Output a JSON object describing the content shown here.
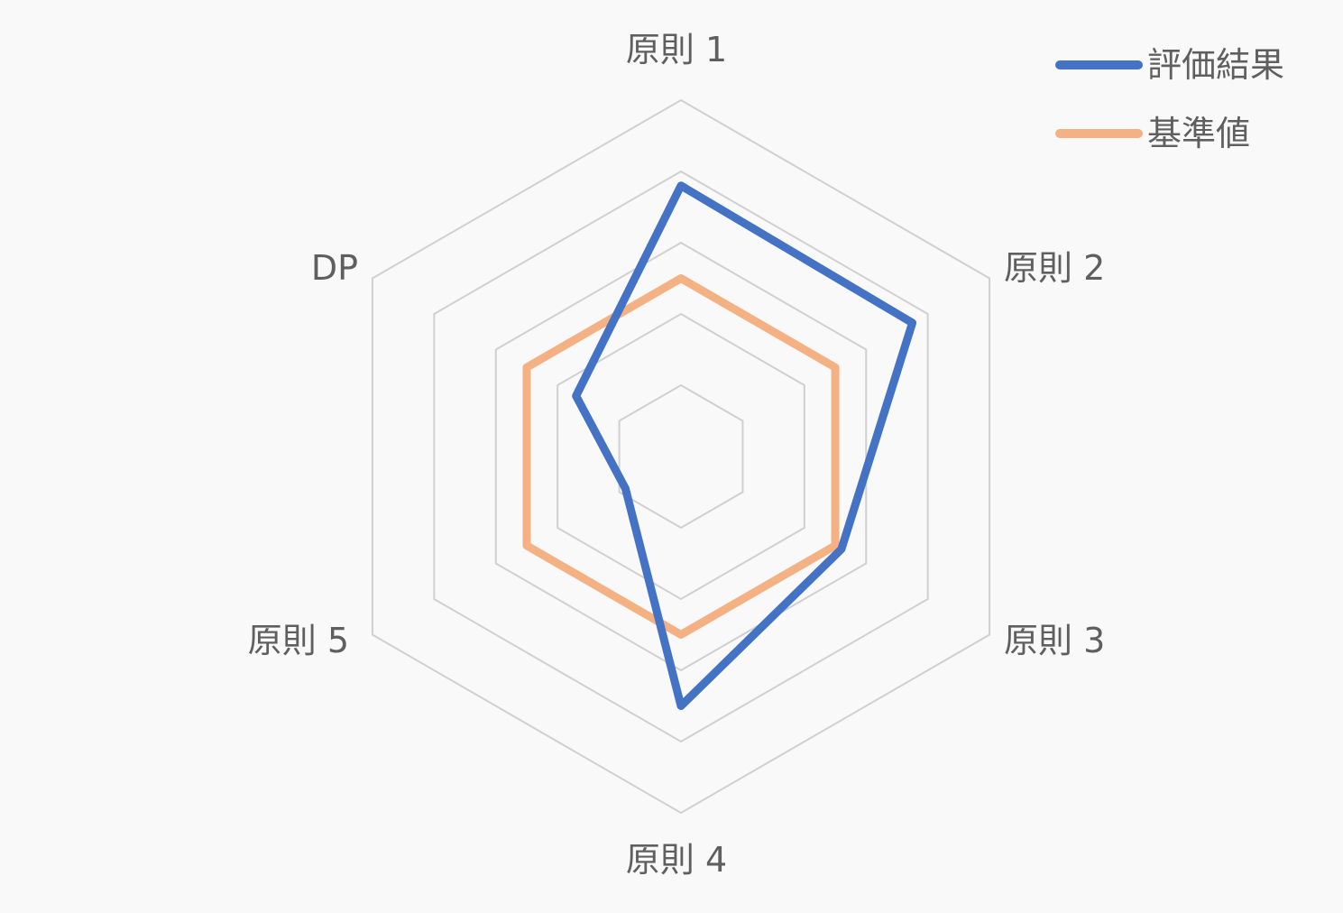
{
  "chart_data": {
    "type": "radar",
    "categories": [
      "原則 1",
      "原則 2",
      "原則 3",
      "原則 4",
      "原則 5",
      "DP"
    ],
    "series": [
      {
        "name": "評価結果",
        "values": [
          3.8,
          3.75,
          2.6,
          3.5,
          0.9,
          1.7
        ],
        "color": "#4472c4"
      },
      {
        "name": "基準値",
        "values": [
          2.5,
          2.5,
          2.5,
          2.5,
          2.5,
          2.5
        ],
        "color": "#f4b183"
      }
    ],
    "rlim": [
      0,
      5
    ],
    "grid_levels": [
      1,
      2,
      3,
      4,
      5
    ],
    "grid": true,
    "legend_position": "top-right",
    "grid_color": "#d0d0d0"
  }
}
